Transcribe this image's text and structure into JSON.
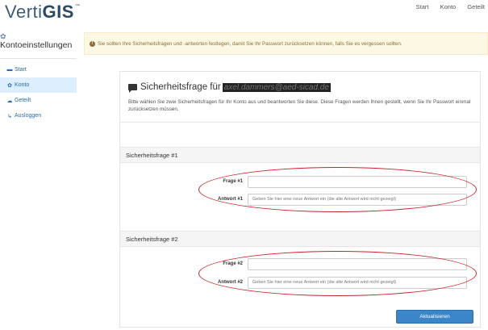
{
  "brand": {
    "prefix": "Verti",
    "bold": "GIS",
    "tm": "™"
  },
  "topnav": {
    "items": [
      "Start",
      "Konto",
      "Geteilt"
    ]
  },
  "sidebar": {
    "title": "Kontoeinstellungen",
    "items": [
      {
        "label": "Start",
        "icon": "folder-icon"
      },
      {
        "label": "Konto",
        "icon": "gear-icon",
        "active": true
      },
      {
        "label": "Geteilt",
        "icon": "cloud-icon"
      },
      {
        "label": "Ausloggen",
        "icon": "logout-icon"
      }
    ]
  },
  "alert": {
    "text": "Sie sollten Ihre Sicherheitsfragen und -antworten festlegen, damit Sie Ihr Passwort zurücksetzen können, falls Sie es vergessen sollten."
  },
  "panel": {
    "title": "Sicherheitsfrage für",
    "email": "axel.dammers@aed-sicad.de",
    "description": "Bitte wählen Sie zwei Sicherheitsfragen für Ihr Konto aus und beantworten Sie diese. Diese Fragen werden Ihnen gestellt, wenn Sie Ihr Passwort einmal zurücksetzen müssen."
  },
  "section1": {
    "heading": "Sicherheitsfrage #1",
    "question_label": "Frage #1",
    "question_value": "",
    "answer_label": "Antwort #1",
    "answer_placeholder": "Geben Sie hier eine neue Antwort ein (die alte Antwort wird nicht gezeigt)"
  },
  "section2": {
    "heading": "Sicherheitsfrage #2",
    "question_label": "Frage #2",
    "question_value": "",
    "answer_label": "Antwort #2",
    "answer_placeholder": "Geben Sie hier eine neue Antwort ein (die alte Antwort wird nicht gezeigt)"
  },
  "submit_label": "Aktualisieren",
  "colors": {
    "primary": "#3a86c8",
    "annotation": "#c8232c",
    "alert_bg": "#fcf8e3"
  }
}
